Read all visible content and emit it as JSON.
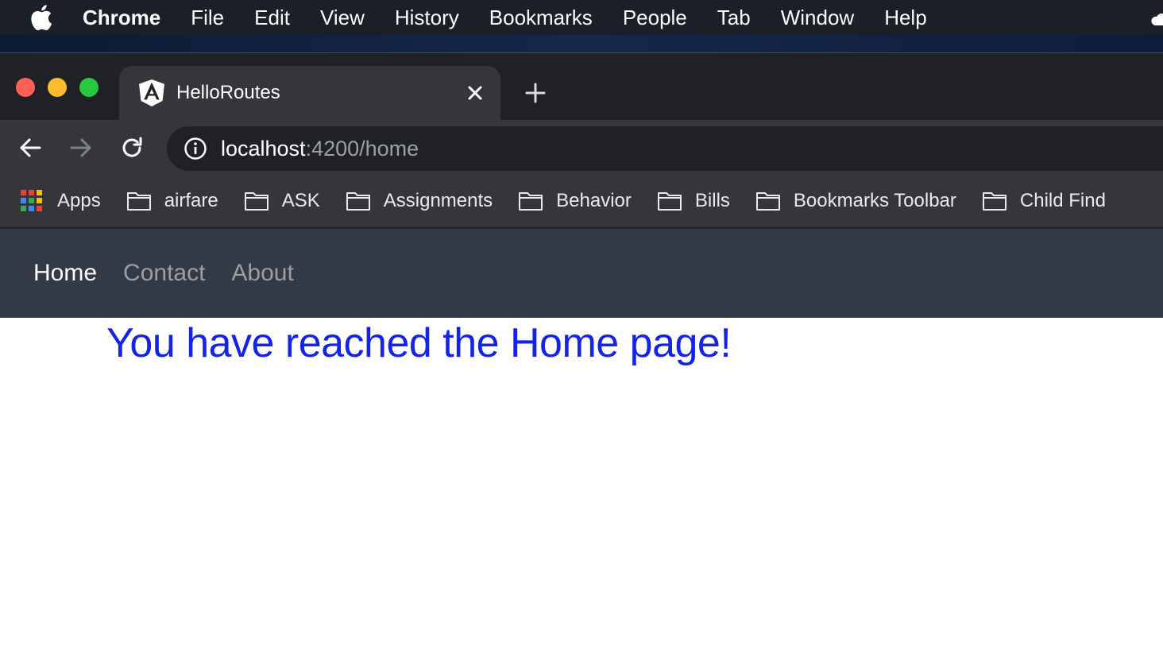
{
  "menubar": {
    "icon": "apple-logo-icon",
    "items": [
      "Chrome",
      "File",
      "Edit",
      "View",
      "History",
      "Bookmarks",
      "People",
      "Tab",
      "Window",
      "Help"
    ]
  },
  "browser": {
    "tab": {
      "title": "HelloRoutes",
      "favicon": "angular-logo-icon"
    },
    "address": {
      "host": "localhost",
      "rest": ":4200/home"
    },
    "bookmarks": [
      "Apps",
      "airfare",
      "ASK",
      "Assignments",
      "Behavior",
      "Bills",
      "Bookmarks Toolbar",
      "Child Find"
    ]
  },
  "page": {
    "nav": {
      "items": [
        "Home",
        "Contact",
        "About"
      ],
      "active": "Home"
    },
    "heading": "You have reached the Home page!"
  },
  "colors": {
    "menubar_bg": "#1b2028",
    "tabstrip_bg": "#202124",
    "toolbar_bg": "#35363a",
    "nav_bg": "#343a45",
    "heading": "#1324e8"
  }
}
